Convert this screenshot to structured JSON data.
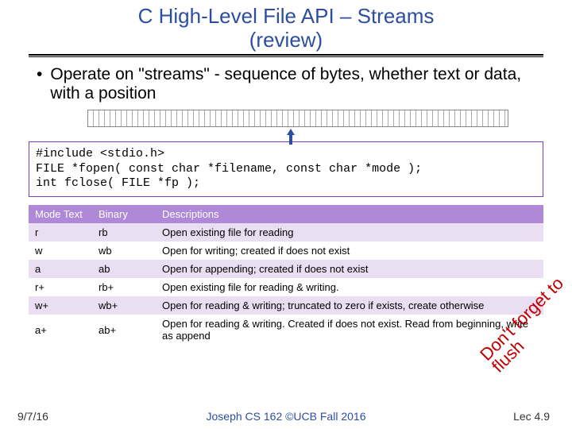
{
  "title_line1": "C High-Level File API – Streams",
  "title_line2": "(review)",
  "bullet_text": "Operate on \"streams\" - sequence of bytes, whether text or data, with a position",
  "code": "#include <stdio.h>\nFILE *fopen( const char *filename, const char *mode );\nint fclose( FILE *fp );",
  "table": {
    "headers": {
      "mode": "Mode Text",
      "binary": "Binary",
      "desc": "Descriptions"
    },
    "rows": [
      {
        "mode": "r",
        "binary": "rb",
        "desc": "Open existing file for reading"
      },
      {
        "mode": "w",
        "binary": "wb",
        "desc": "Open for writing; created if does not exist"
      },
      {
        "mode": "a",
        "binary": "ab",
        "desc": "Open for appending; created if does not exist"
      },
      {
        "mode": "r+",
        "binary": "rb+",
        "desc": "Open existing file for reading & writing."
      },
      {
        "mode": "w+",
        "binary": "wb+",
        "desc": "Open for reading & writing; truncated to zero if exists, create otherwise"
      },
      {
        "mode": "a+",
        "binary": "ab+",
        "desc": "Open for reading & writing. Created if does not exist. Read from beginning, write as append"
      }
    ]
  },
  "diag1": "Don't forget to",
  "diag2": "flush",
  "footer": {
    "date": "9/7/16",
    "center": "Joseph CS 162 ©UCB Fall 2016",
    "lec": "Lec 4.9"
  }
}
